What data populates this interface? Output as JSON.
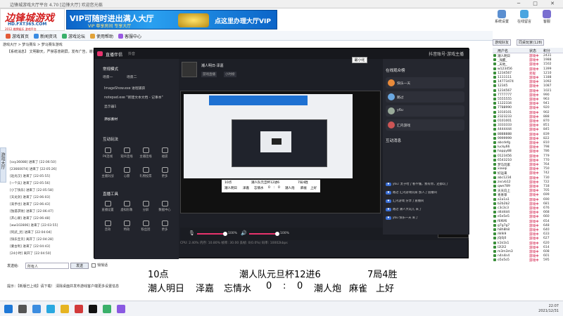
{
  "app": {
    "title": "边锋城游戏大厅平台 4.70 [边锋大厅] 欢迎您光临",
    "logo_line1": "边锋城游戏",
    "logo_line2": "HD.FXT365.COM",
    "logo_line3": "2012 棋牌娱乐 游戏平台"
  },
  "banner": {
    "left_text": "VIP可随时进出满人大厅",
    "left_sub": "VIP 尊享房间 专享大厅",
    "right_text": "点这里办理大厅VIP"
  },
  "toolbar": {
    "items": [
      "游戏首页",
      "新闻资讯",
      "游戏论坛",
      "使用帮助",
      "客服中心"
    ]
  },
  "breadcrumb": "游戏大厅 > 梦马赛车 > 梦马赛车游戏",
  "notice": "【系统消息】 文明聊天，严禁恶意刷屏，发布广告，谢谢合作",
  "sidebar_tab": "游戏大厅",
  "chat_log": [
    "[sxy36088] 进来了 [22:06:50]",
    "[23660074] 进来了 [22:05:26]",
    "[赵光汉] 进来了 [22:05:55]",
    "[一个兵] 进来了 [22:05:56]",
    "[小丁快乐] 进来了 [22:05:58]",
    "[天龙剑] 进来了 [22:06:03]",
    "[高手也] 进来了 [22:06:43]",
    "[独孤求败] 进来了 [22:06:47]",
    "[开心果] 进来了 [22:06:48]",
    "[ww102806] 进来了 [22:03:55]",
    "[阿武_灵] 进来了 [22:04:04]",
    "[快乐宝贝] 离开了 [22:04:28]",
    "[蒙古利] 进来了 [22:04:43]",
    "[24小时] 离开了 [22:04:50]"
  ],
  "chat_input": {
    "label": "发送给:",
    "value": "所有人",
    "send_label": "发送",
    "checkbox_label": "悄悄话"
  },
  "status_tip": "提示：【新版已上线】请下载！ 清除桌面并发布游戏客户端更多设置信息",
  "right_icons": [
    "系统设置",
    "在线留言",
    "客服"
  ],
  "right_tabs": [
    "游戏好友",
    "同桌玩家(128)"
  ],
  "user_header": [
    "用户名",
    "状态",
    "积分"
  ],
  "users": [
    {
      "name": "潮人明日",
      "status": "游戏中",
      "score": "2431"
    },
    {
      "name": "_浅醒_",
      "status": "游戏中",
      "score": "1988"
    },
    {
      "name": "_天地_",
      "status": "游戏中",
      "score": "1502"
    },
    {
      "name": "w123456",
      "status": "游戏中",
      "score": "1399"
    },
    {
      "name": "1234567",
      "status": "旁观",
      "score": "1210"
    },
    {
      "name": "1111111",
      "status": "游戏中",
      "score": "1188"
    },
    {
      "name": "14773474",
      "status": "游戏中",
      "score": "1092"
    },
    {
      "name": "12345",
      "status": "游戏中",
      "score": "1087"
    },
    {
      "name": "1234567",
      "status": "游戏中",
      "score": "1021"
    },
    {
      "name": "7777777",
      "status": "游戏中",
      "score": "990"
    },
    {
      "name": "5555555",
      "status": "游戏中",
      "score": "963"
    },
    {
      "name": "1122334",
      "status": "游戏中",
      "score": "941"
    },
    {
      "name": "7788990",
      "status": "游戏中",
      "score": "920"
    },
    {
      "name": "1010101",
      "status": "游戏中",
      "score": "902"
    },
    {
      "name": "2323233",
      "status": "游戏中",
      "score": "888"
    },
    {
      "name": "0101001",
      "status": "游戏中",
      "score": "870"
    },
    {
      "name": "3333333",
      "status": "游戏中",
      "score": "851"
    },
    {
      "name": "4444444",
      "status": "游戏中",
      "score": "845"
    },
    {
      "name": "8888888",
      "status": "游戏中",
      "score": "839"
    },
    {
      "name": "9999999",
      "status": "游戏中",
      "score": "822"
    },
    {
      "name": "abcdefg",
      "status": "游戏中",
      "score": "810"
    },
    {
      "name": "lucky66",
      "status": "游戏中",
      "score": "798"
    },
    {
      "name": "happy88",
      "status": "游戏中",
      "score": "786"
    },
    {
      "name": "0123456",
      "status": "游戏中",
      "score": "779"
    },
    {
      "name": "6543210",
      "status": "游戏中",
      "score": "770"
    },
    {
      "name": "梦马玩家",
      "status": "游戏中",
      "score": "764"
    },
    {
      "name": "xiaoqi",
      "status": "游戏中",
      "score": "750"
    },
    {
      "name": "好运来",
      "status": "游戏中",
      "score": "742"
    },
    {
      "name": "abc1234",
      "status": "游戏中",
      "score": "730"
    },
    {
      "name": "zxcvb12",
      "status": "游戏中",
      "score": "722"
    },
    {
      "name": "qwe789",
      "status": "游戏中",
      "score": "718"
    },
    {
      "name": "天天向上",
      "status": "游戏中",
      "score": "705"
    },
    {
      "name": "青青草",
      "status": "游戏中",
      "score": "699"
    },
    {
      "name": "a1a1a1",
      "status": "游戏中",
      "score": "690"
    },
    {
      "name": "b2b2b2",
      "status": "游戏中",
      "score": "681"
    },
    {
      "name": "c3c3c3",
      "status": "游戏中",
      "score": "676"
    },
    {
      "name": "d4d4d4",
      "status": "游戏中",
      "score": "668"
    },
    {
      "name": "e5e5e5",
      "status": "游戏中",
      "score": "660"
    },
    {
      "name": "f6f6f6",
      "status": "游戏中",
      "score": "654"
    },
    {
      "name": "g7g7g7",
      "status": "游戏中",
      "score": "648"
    },
    {
      "name": "h8h8h8",
      "status": "游戏中",
      "score": "640"
    },
    {
      "name": "i9i9i9",
      "status": "游戏中",
      "score": "633"
    },
    {
      "name": "j0j0j0",
      "status": "游戏中",
      "score": "627"
    },
    {
      "name": "k1k1k1",
      "status": "游戏中",
      "score": "620"
    },
    {
      "name": "l2l2l2",
      "status": "游戏中",
      "score": "614"
    },
    {
      "name": "m3m3m3",
      "status": "游戏中",
      "score": "608"
    },
    {
      "name": "n4n4n4",
      "status": "游戏中",
      "score": "601"
    },
    {
      "name": "o5o5o5",
      "status": "游戏中",
      "score": "595"
    }
  ],
  "obs": {
    "title": "直播伴侣",
    "title2": "抖音",
    "header_right": "抖音账号·游戏主播",
    "scene_mode": "常规模式",
    "scene_tabs": [
      "场景一",
      "场景二"
    ],
    "sources": [
      "ImageShow.exe 进程捕获",
      "notepad.exe \"新建文本文档 - 记事本\"",
      "显示器1"
    ],
    "add_source": "添加素材",
    "interact_title": "互动玩法",
    "interact_items": [
      "PK连线",
      "观众连线",
      "主播连线",
      "福袋",
      "主播对战",
      "心愿",
      "礼物投票",
      "更多"
    ],
    "tools_title": "直播工具",
    "tools_items": [
      "直播设置",
      "虚拟形象",
      "分屏",
      "数据中心",
      "音效",
      "特效",
      "粉丝团",
      "更多"
    ],
    "stream_title": "潮人明日·泽嘉",
    "stream_sub": "游戏直播",
    "stream_tag": "小时榜",
    "online_title": "在线观众榜",
    "online_users": [
      "快乐一天",
      "路过",
      "y6u",
      "汇内游戏"
    ],
    "messages_title": "互动消息",
    "messages": [
      "y6u: 太子哈了看不懂，我有你，还都玩了",
      "路过 汇内游戏玩家 加入了直播间",
      "汇内游戏 分享了直播间",
      "路过 潮人大玩儿 来了",
      "y6u 快乐一天 来了"
    ],
    "timer": "00:11:07",
    "tooltip": "最小化",
    "volume1": "100%",
    "volume2": "100%",
    "status_line": "CPU: 2.40%   内存: 10.80%   帧率: 30.00   丢帧: 0(0.0%)   码率: 10002kbps"
  },
  "score": {
    "line1": [
      "10点",
      "潮人队元旦杯12进6",
      "7局4胜"
    ],
    "line2": [
      "潮人明日",
      "泽嘉",
      "忘情水",
      "0",
      ":",
      "0",
      "潮人炮",
      "麻雀",
      "上好"
    ]
  },
  "preview_footer": {
    "line1": [
      "10点",
      "潮人队元旦杯12进6",
      "7局4胜"
    ],
    "line2": [
      "潮人明日",
      "泽嘉",
      "忘情水",
      "0",
      ":",
      "0",
      "潮人炮",
      "麻雀",
      "上好"
    ]
  },
  "tray": {
    "time": "22:07",
    "date": "2021/12/31"
  },
  "colors": {
    "accent": "#e8336d",
    "banner": "#0b64c8",
    "obs_bg": "#1d1f26"
  }
}
